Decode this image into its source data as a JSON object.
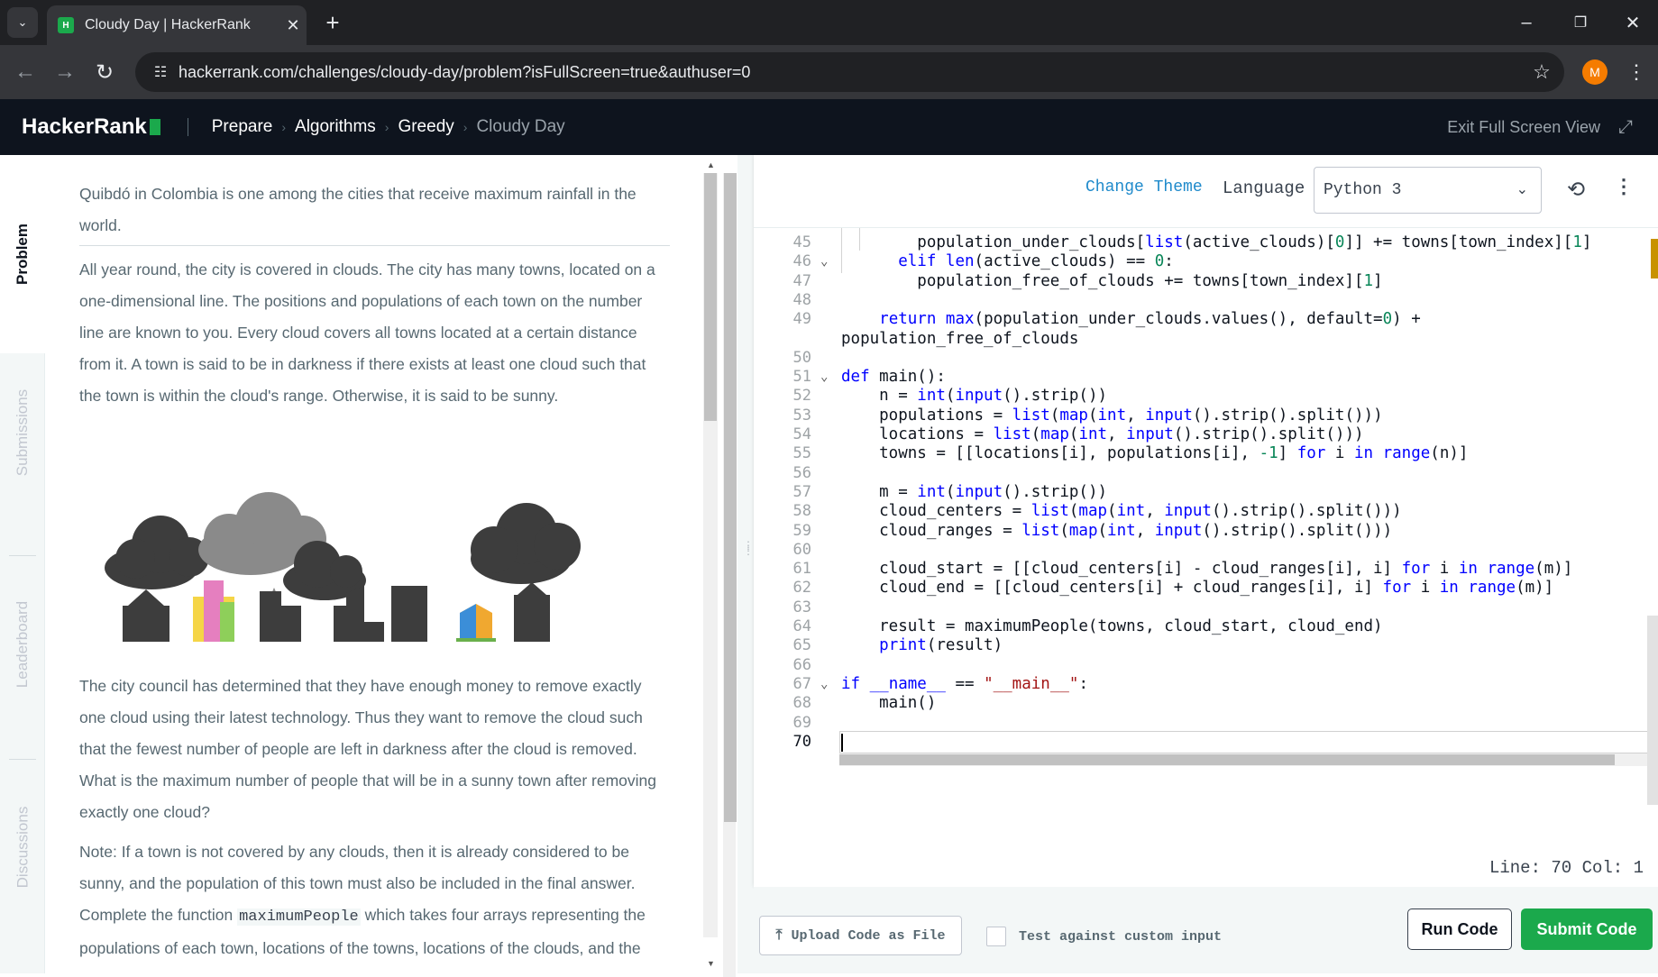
{
  "browser": {
    "tab_title": "Cloudy Day | HackerRank",
    "favicon_text": "H",
    "url": "hackerrank.com/challenges/cloudy-day/problem?isFullScreen=true&authuser=0",
    "profile_initial": "M"
  },
  "header": {
    "logo": "HackerRank",
    "breadcrumbs": [
      "Prepare",
      "Algorithms",
      "Greedy",
      "Cloudy Day"
    ],
    "exit_fullscreen": "Exit Full Screen View"
  },
  "sidetabs": [
    "Problem",
    "Submissions",
    "Leaderboard",
    "Discussions"
  ],
  "problem": {
    "intro": "Quibdó in Colombia is one among the cities that receive maximum rainfall in the world.",
    "p1": "All year round, the city is covered in clouds. The city has many towns, located on a one-dimensional line. The positions and populations of each town on the number line are known to you. Every cloud covers all towns located at a certain distance from it. A town is said to be in darkness if there exists at least one cloud such that the town is within the cloud's range. Otherwise, it is said to be sunny.",
    "p2": "The city council has determined that they have enough money to remove exactly one cloud using their latest technology. Thus they want to remove the cloud such that the fewest number of people are left in darkness after the cloud is removed. What is the maximum number of people that will be in a sunny town after removing exactly one cloud?",
    "p3": "Note: If a town is not covered by any clouds, then it is already considered to be sunny, and the population of this town must also be included in the final answer.",
    "p4_before": "Complete the function ",
    "p4_code": "maximumPeople",
    "p4_after": " which takes four arrays representing the populations of each town, locations of the towns, locations of the clouds, and the"
  },
  "editor": {
    "change_theme": "Change Theme",
    "language_label": "Language",
    "language_value": "Python 3",
    "status": "Line: 70 Col: 1",
    "lines": [
      {
        "n": "45",
        "html": "        population_under_clouds[<span class=\"kw\">list</span>(active_clouds)[<span class=\"num\">0</span>]] += towns[town_index][<span class=\"num\">1</span>]"
      },
      {
        "n": "46",
        "html": "      <span class=\"kw\">elif</span> <span class=\"kw\">len</span>(active_clouds) == <span class=\"num\">0</span>:",
        "fold": true
      },
      {
        "n": "47",
        "html": "        population_free_of_clouds += towns[town_index][<span class=\"num\">1</span>]"
      },
      {
        "n": "48",
        "html": ""
      },
      {
        "n": "49",
        "html": "    <span class=\"kw\">return</span> <span class=\"kw\">max</span>(population_under_clouds.values(), default=<span class=\"num\">0</span>) +"
      },
      {
        "n": "",
        "html": "population_free_of_clouds"
      },
      {
        "n": "50",
        "html": ""
      },
      {
        "n": "51",
        "html": "<span class=\"kw\">def</span> main():",
        "fold": true
      },
      {
        "n": "52",
        "html": "    n = <span class=\"kw\">int</span>(<span class=\"kw\">input</span>().strip())"
      },
      {
        "n": "53",
        "html": "    populations = <span class=\"kw\">list</span>(<span class=\"kw\">map</span>(<span class=\"kw\">int</span>, <span class=\"kw\">input</span>().strip().split()))"
      },
      {
        "n": "54",
        "html": "    locations = <span class=\"kw\">list</span>(<span class=\"kw\">map</span>(<span class=\"kw\">int</span>, <span class=\"kw\">input</span>().strip().split()))"
      },
      {
        "n": "55",
        "html": "    towns = [[locations[i], populations[i], <span class=\"num\">-1</span>] <span class=\"kw\">for</span> i <span class=\"kw\">in</span> <span class=\"kw\">range</span>(n)]"
      },
      {
        "n": "56",
        "html": ""
      },
      {
        "n": "57",
        "html": "    m = <span class=\"kw\">int</span>(<span class=\"kw\">input</span>().strip())"
      },
      {
        "n": "58",
        "html": "    cloud_centers = <span class=\"kw\">list</span>(<span class=\"kw\">map</span>(<span class=\"kw\">int</span>, <span class=\"kw\">input</span>().strip().split()))"
      },
      {
        "n": "59",
        "html": "    cloud_ranges = <span class=\"kw\">list</span>(<span class=\"kw\">map</span>(<span class=\"kw\">int</span>, <span class=\"kw\">input</span>().strip().split()))"
      },
      {
        "n": "60",
        "html": ""
      },
      {
        "n": "61",
        "html": "    cloud_start = [[cloud_centers[i] - cloud_ranges[i], i] <span class=\"kw\">for</span> i <span class=\"kw\">in</span> <span class=\"kw\">range</span>(m)]"
      },
      {
        "n": "62",
        "html": "    cloud_end = [[cloud_centers[i] + cloud_ranges[i], i] <span class=\"kw\">for</span> i <span class=\"kw\">in</span> <span class=\"kw\">range</span>(m)]"
      },
      {
        "n": "63",
        "html": ""
      },
      {
        "n": "64",
        "html": "    result = maximumPeople(towns, cloud_start, cloud_end)"
      },
      {
        "n": "65",
        "html": "    <span class=\"kw\">print</span>(result)"
      },
      {
        "n": "66",
        "html": ""
      },
      {
        "n": "67",
        "html": "<span class=\"kw\">if</span> <span class=\"kw\">__name__</span> == <span class=\"str\">\"__main__\"</span>:",
        "fold": true
      },
      {
        "n": "68",
        "html": "    main()"
      },
      {
        "n": "69",
        "html": ""
      },
      {
        "n": "70",
        "html": "",
        "current": true
      }
    ]
  },
  "actions": {
    "upload": "Upload Code as File",
    "custom_input": "Test against custom input",
    "run": "Run Code",
    "submit": "Submit Code"
  },
  "colors": {
    "brand_green": "#1ba94c",
    "header_bg": "#0e141e",
    "link_blue": "#1f8acb",
    "keyword_blue": "#0000ff"
  },
  "icons": [
    "tab-list-icon",
    "close-icon",
    "plus-icon",
    "minimize-icon",
    "restore-icon",
    "window-close-icon",
    "back-icon",
    "forward-icon",
    "reload-icon",
    "site-settings-icon",
    "bookmark-star-icon",
    "kebab-menu-icon",
    "exit-fullscreen-icon",
    "chevron-down-icon",
    "history-icon",
    "upload-icon"
  ]
}
